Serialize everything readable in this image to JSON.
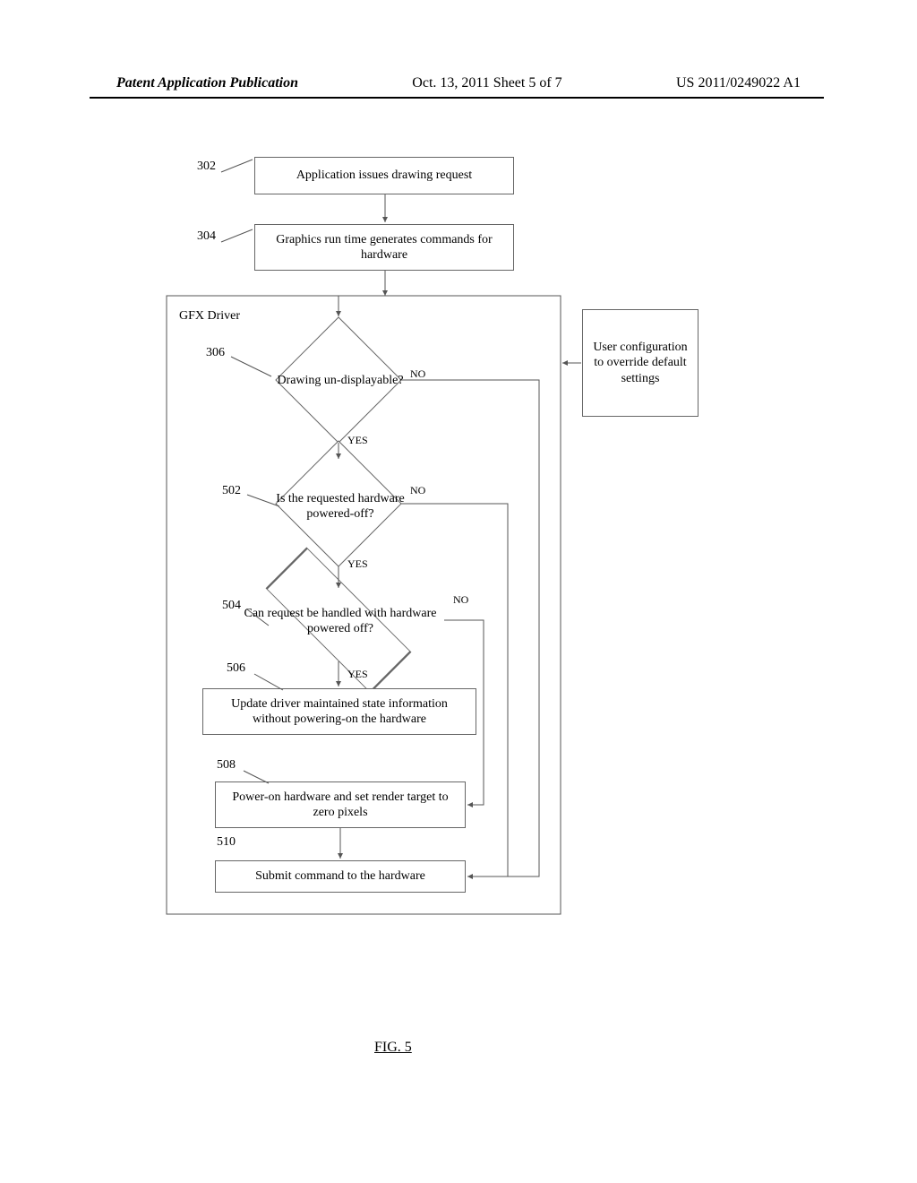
{
  "header": {
    "publication": "Patent Application Publication",
    "date": "Oct. 13, 2011  Sheet 5 of 7",
    "docnum": "US 2011/0249022 A1"
  },
  "figure_caption": "FIG. 5",
  "refs": {
    "r302": "302",
    "r304": "304",
    "r306": "306",
    "r502": "502",
    "r504": "504",
    "r506": "506",
    "r508": "508",
    "r510": "510"
  },
  "boxes": {
    "b302": "Application issues drawing request",
    "b304": "Graphics run time generates commands for hardware",
    "gfx_driver_label": "GFX Driver",
    "user_config": "User configuration to override default settings",
    "b506": "Update driver maintained state information without powering-on the hardware",
    "b508": "Power-on hardware and set render target to zero pixels",
    "b510": "Submit command to the hardware"
  },
  "decisions": {
    "d306": "Drawing un-displayable?",
    "d502": "Is the requested hardware powered-off?",
    "d504": "Can request be handled with hardware powered off?"
  },
  "branch": {
    "yes": "YES",
    "no": "NO"
  },
  "chart_data": {
    "type": "flowchart",
    "nodes": [
      {
        "id": "302",
        "type": "process",
        "label": "Application issues drawing request"
      },
      {
        "id": "304",
        "type": "process",
        "label": "Graphics run time generates commands for hardware"
      },
      {
        "id": "gfx_driver",
        "type": "container",
        "label": "GFX Driver",
        "children": [
          "306",
          "502",
          "504",
          "506",
          "508",
          "510"
        ]
      },
      {
        "id": "306",
        "type": "decision",
        "label": "Drawing un-displayable?"
      },
      {
        "id": "502",
        "type": "decision",
        "label": "Is the requested hardware powered-off?"
      },
      {
        "id": "504",
        "type": "decision",
        "label": "Can request be handled with hardware powered off?"
      },
      {
        "id": "506",
        "type": "process",
        "label": "Update driver maintained state information without powering-on the hardware"
      },
      {
        "id": "508",
        "type": "process",
        "label": "Power-on hardware and set render target to zero pixels"
      },
      {
        "id": "510",
        "type": "process",
        "label": "Submit command to the hardware"
      },
      {
        "id": "user_config",
        "type": "process",
        "label": "User configuration to override default settings"
      }
    ],
    "edges": [
      {
        "from": "302",
        "to": "304"
      },
      {
        "from": "304",
        "to": "306"
      },
      {
        "from": "306",
        "to": "502",
        "label": "YES"
      },
      {
        "from": "306",
        "to": "510",
        "label": "NO"
      },
      {
        "from": "502",
        "to": "504",
        "label": "YES"
      },
      {
        "from": "502",
        "to": "510",
        "label": "NO"
      },
      {
        "from": "504",
        "to": "506",
        "label": "YES"
      },
      {
        "from": "504",
        "to": "508",
        "label": "NO"
      },
      {
        "from": "508",
        "to": "510"
      },
      {
        "from": "user_config",
        "to": "gfx_driver"
      }
    ]
  }
}
